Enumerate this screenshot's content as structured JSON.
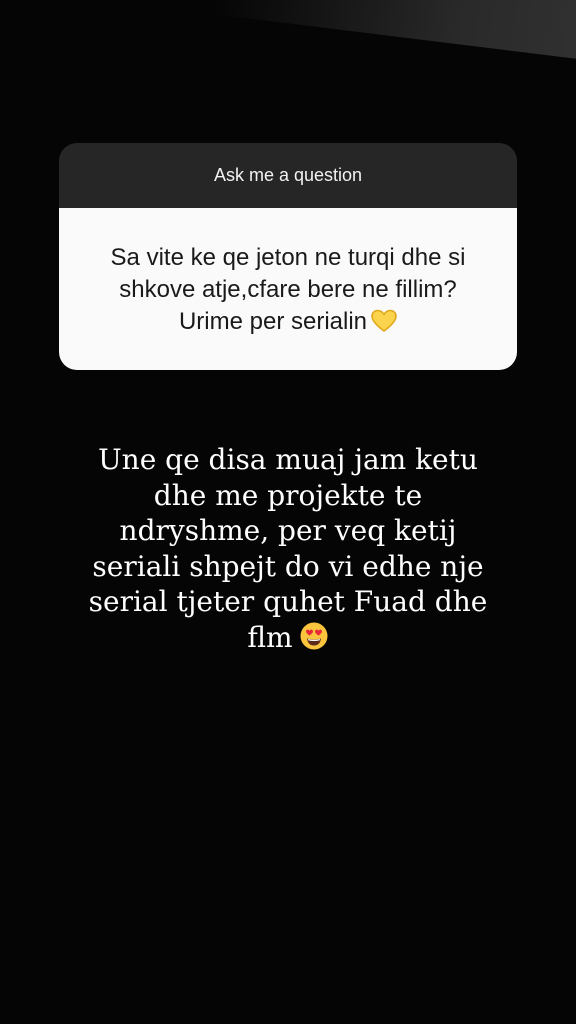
{
  "question_sticker": {
    "header_label": "Ask me a question",
    "question": "Sa vite ke qe jeton ne turqi dhe si\nshkove atje,cfare bere ne fillim?\nUrime per serialin"
  },
  "answer": {
    "text": "Une qe disa muaj jam ketu\ndhe me projekte te\nndryshme, per veq ketij\nseriali shpejt do vi edhe nje\nserial tjeter quhet Fuad dhe\nflm"
  },
  "emojis": {
    "question_end": "yellow-heart-icon",
    "answer_end": "heart-eyes-face-icon"
  },
  "colors": {
    "background": "#050505",
    "card_header": "#262626",
    "card_body": "#fafafa",
    "answer_text": "#ffffff"
  }
}
